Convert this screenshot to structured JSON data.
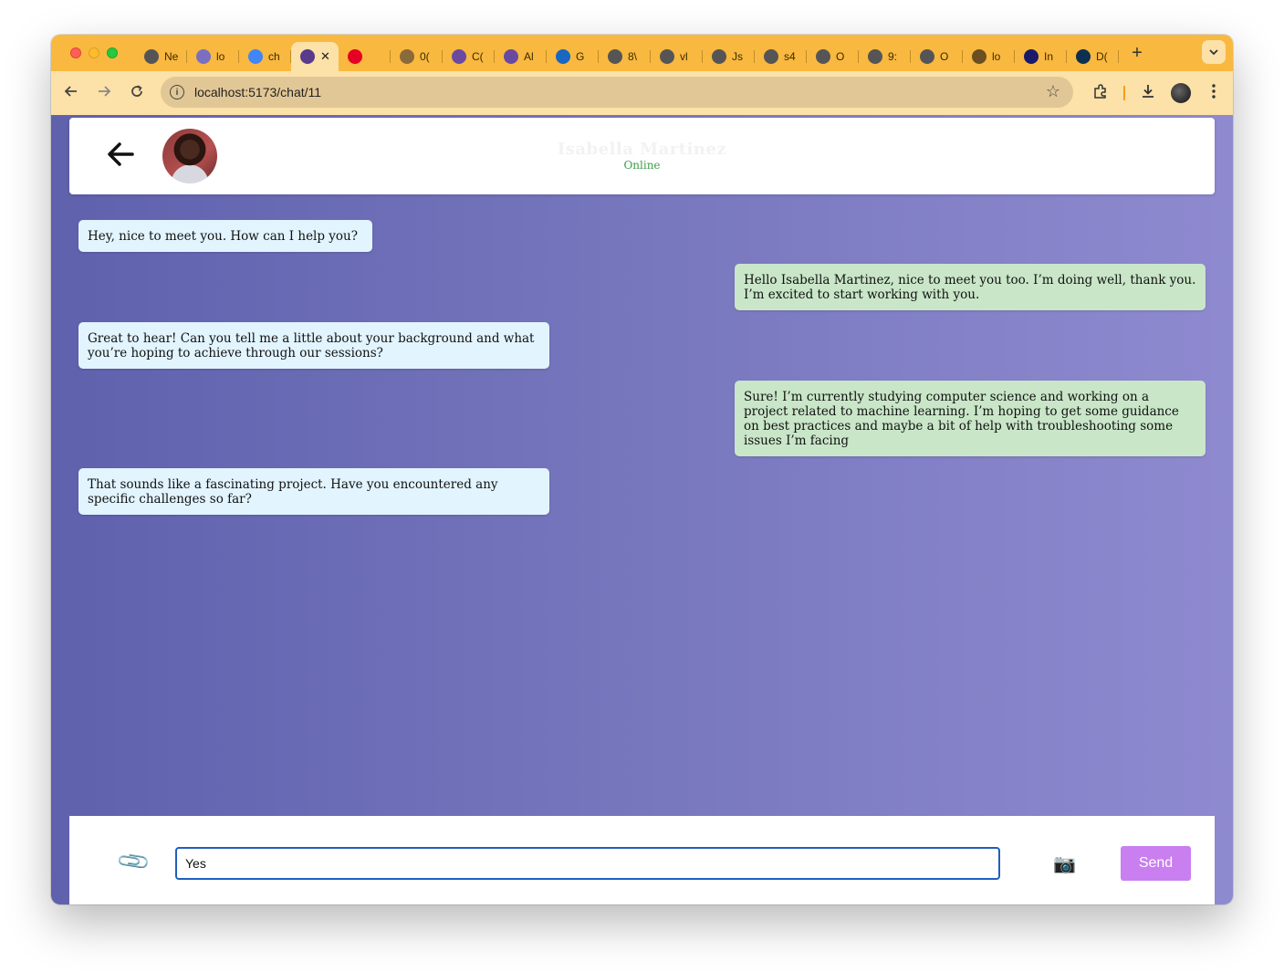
{
  "browser": {
    "tabs": [
      {
        "label": "Ne",
        "favicon": "chrome-icon",
        "color": "#555555"
      },
      {
        "label": "lo",
        "favicon": "lightbulb-icon",
        "color": "#7a6fc0"
      },
      {
        "label": "ch",
        "favicon": "google-icon",
        "color": "#4285f4"
      },
      {
        "label": "",
        "favicon": "app-icon",
        "color": "#5a3a8a",
        "active": true
      },
      {
        "label": "",
        "favicon": "pinterest-icon",
        "color": "#e60023"
      },
      {
        "label": "0(",
        "favicon": "loading-icon",
        "color": "#8a6a3a"
      },
      {
        "label": "C(",
        "favicon": "chat-icon",
        "color": "#6a4aa0"
      },
      {
        "label": "Al",
        "favicon": "chat-icon",
        "color": "#6a4aa0"
      },
      {
        "label": "G",
        "favicon": "vuetify-icon",
        "color": "#1867c0"
      },
      {
        "label": "8\\",
        "favicon": "globe-icon",
        "color": "#555555"
      },
      {
        "label": "vl",
        "favicon": "globe-icon",
        "color": "#555555"
      },
      {
        "label": "Js",
        "favicon": "globe-icon",
        "color": "#555555"
      },
      {
        "label": "s4",
        "favicon": "globe-icon",
        "color": "#555555"
      },
      {
        "label": "O",
        "favicon": "globe-icon",
        "color": "#555555"
      },
      {
        "label": "9:",
        "favicon": "globe-icon",
        "color": "#555555"
      },
      {
        "label": "O",
        "favicon": "globe-icon",
        "color": "#555555"
      },
      {
        "label": "lo",
        "favicon": "target-icon",
        "color": "#6a5020"
      },
      {
        "label": "In",
        "favicon": "p-icon",
        "color": "#1a1a6a"
      },
      {
        "label": "D(",
        "favicon": "d-icon",
        "color": "#0d3050"
      }
    ],
    "close_glyph": "✕",
    "newtab_glyph": "+",
    "url": "localhost:5173/chat/11"
  },
  "chat": {
    "contact_name": "Isabella Martinez",
    "status": "Online",
    "messages": [
      {
        "side": "in",
        "text": "Hey, nice to meet you. How can I help you?"
      },
      {
        "side": "out",
        "text": "Hello Isabella Martinez, nice to meet you too. I’m doing well, thank you. I’m excited to start working with you."
      },
      {
        "side": "in",
        "text": "Great to hear! Can you tell me a little about your background and what you’re hoping to achieve through our sessions?"
      },
      {
        "side": "out",
        "text": "Sure! I’m currently studying computer science and working on a project related to machine learning. I’m hoping to get some guidance on best practices and maybe a bit of help with troubleshooting some issues I’m facing"
      },
      {
        "side": "in",
        "text": "That sounds like a fascinating project. Have you encountered any specific challenges so far?"
      }
    ],
    "input_value": "Yes",
    "send_label": "Send",
    "camera_glyph": "📷",
    "clip_glyph": "📎"
  },
  "colors": {
    "tabstrip": "#f9b83f",
    "toolbar": "#fce1a8",
    "incoming_bubble": "#e2f4fe",
    "outgoing_bubble": "#c9e6c8",
    "send_button": "#c97ff0",
    "status_online": "#3e9e4a"
  }
}
